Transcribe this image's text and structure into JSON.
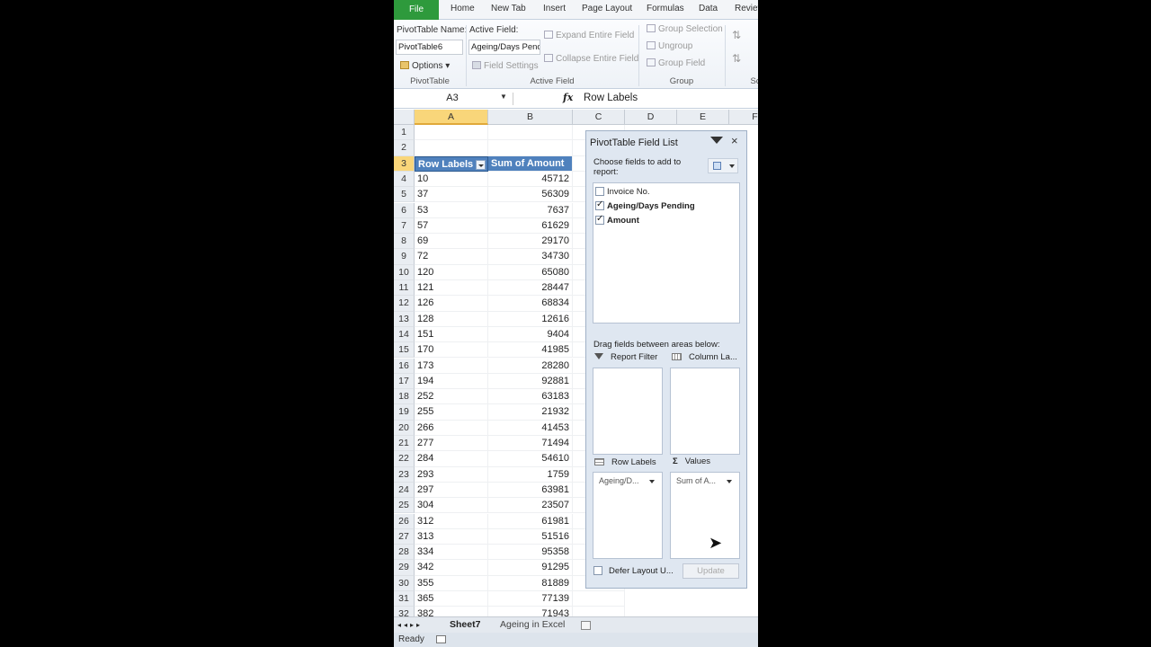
{
  "ribbon_tabs": [
    "File",
    "Home",
    "New Tab",
    "Insert",
    "Page Layout",
    "Formulas",
    "Data",
    "Review"
  ],
  "ribbon": {
    "pivot_name_label": "PivotTable Name:",
    "pivot_name_value": "PivotTable6",
    "options_label": "Options",
    "pivot_group": "PivotTable",
    "active_field_label": "Active Field:",
    "active_field_value": "Ageing/Days Penc",
    "field_settings": "Field Settings",
    "expand_field": "Expand Entire Field",
    "collapse_field": "Collapse Entire Field",
    "active_field_group": "Active Field",
    "group_selection": "Group Selection",
    "ungroup": "Ungroup",
    "group_field": "Group Field",
    "group_group": "Group",
    "next_group_partial": "Sc"
  },
  "formula_bar": {
    "name_box": "A3",
    "fx": "fx",
    "content": "Row Labels"
  },
  "grid": {
    "columns": [
      "A",
      "B",
      "C",
      "D",
      "E",
      "F"
    ],
    "header": {
      "row_labels": "Row Labels",
      "sum_of_amount": "Sum of Amount"
    },
    "rows": [
      {
        "r": "1",
        "a": "",
        "b": ""
      },
      {
        "r": "2",
        "a": "",
        "b": ""
      },
      {
        "r": "3",
        "a": "Row Labels",
        "b": "Sum of Amount"
      },
      {
        "r": "4",
        "a": "10",
        "b": "45712"
      },
      {
        "r": "5",
        "a": "37",
        "b": "56309"
      },
      {
        "r": "6",
        "a": "53",
        "b": "7637"
      },
      {
        "r": "7",
        "a": "57",
        "b": "61629"
      },
      {
        "r": "8",
        "a": "69",
        "b": "29170"
      },
      {
        "r": "9",
        "a": "72",
        "b": "34730"
      },
      {
        "r": "10",
        "a": "120",
        "b": "65080"
      },
      {
        "r": "11",
        "a": "121",
        "b": "28447"
      },
      {
        "r": "12",
        "a": "126",
        "b": "68834"
      },
      {
        "r": "13",
        "a": "128",
        "b": "12616"
      },
      {
        "r": "14",
        "a": "151",
        "b": "9404"
      },
      {
        "r": "15",
        "a": "170",
        "b": "41985"
      },
      {
        "r": "16",
        "a": "173",
        "b": "28280"
      },
      {
        "r": "17",
        "a": "194",
        "b": "92881"
      },
      {
        "r": "18",
        "a": "252",
        "b": "63183"
      },
      {
        "r": "19",
        "a": "255",
        "b": "21932"
      },
      {
        "r": "20",
        "a": "266",
        "b": "41453"
      },
      {
        "r": "21",
        "a": "277",
        "b": "71494"
      },
      {
        "r": "22",
        "a": "284",
        "b": "54610"
      },
      {
        "r": "23",
        "a": "293",
        "b": "1759"
      },
      {
        "r": "24",
        "a": "297",
        "b": "63981"
      },
      {
        "r": "25",
        "a": "304",
        "b": "23507"
      },
      {
        "r": "26",
        "a": "312",
        "b": "61981"
      },
      {
        "r": "27",
        "a": "313",
        "b": "51516"
      },
      {
        "r": "28",
        "a": "334",
        "b": "95358"
      },
      {
        "r": "29",
        "a": "342",
        "b": "91295"
      },
      {
        "r": "30",
        "a": "355",
        "b": "81889"
      },
      {
        "r": "31",
        "a": "365",
        "b": "77139"
      },
      {
        "r": "32",
        "a": "382",
        "b": "71943"
      }
    ]
  },
  "field_list": {
    "title": "PivotTable Field List",
    "close": "×",
    "choose_text": "Choose fields to add to report:",
    "fields": [
      {
        "name": "Invoice No.",
        "checked": false
      },
      {
        "name": "Ageing/Days Pending",
        "checked": true
      },
      {
        "name": "Amount",
        "checked": true
      }
    ],
    "drag_text": "Drag fields between areas below:",
    "report_filter": "Report Filter",
    "column_labels": "Column La...",
    "row_labels": "Row Labels",
    "values": "Values",
    "row_chip": "Ageing/D...",
    "values_chip": "Sum of A...",
    "defer_label": "Defer Layout U...",
    "update_button": "Update"
  },
  "sheet_tabs": [
    "Sheet7",
    "Ageing in Excel"
  ],
  "status": "Ready",
  "colors": {
    "file_tab": "#2e9a3c",
    "pivot_header": "#4f81bd",
    "selected_header": "#f9d67a"
  }
}
